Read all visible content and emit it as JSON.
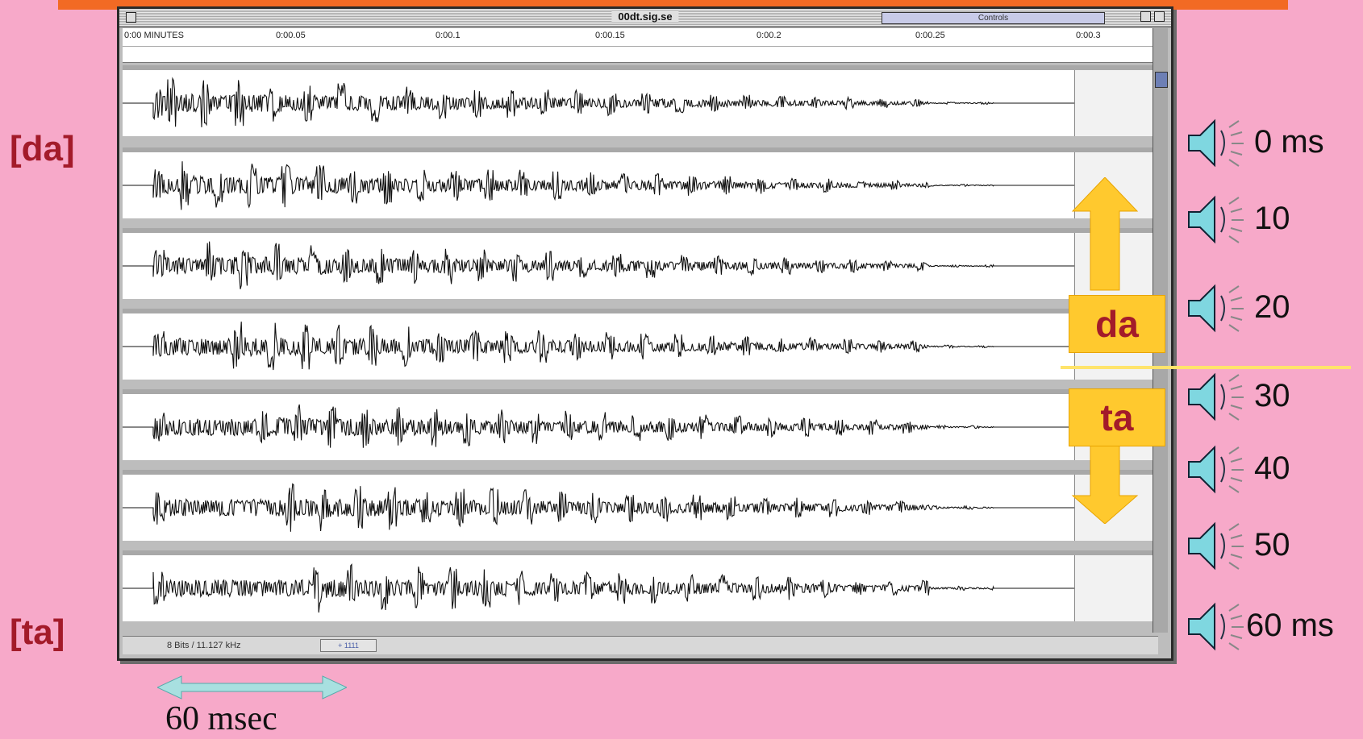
{
  "window": {
    "title": "00dt.sig.se",
    "controls_label": "Controls",
    "format_label": "8 Bits / 11.127 kHz",
    "mini_text": "+ 1111"
  },
  "ruler": {
    "ticks": [
      "0:00 MINUTES",
      "0:00.05",
      "0:00.1",
      "0:00.15",
      "0:00.2",
      "0:00.25",
      "0:00.3"
    ]
  },
  "tracks": [
    {
      "vot_ms": 0
    },
    {
      "vot_ms": 10
    },
    {
      "vot_ms": 20
    },
    {
      "vot_ms": 30
    },
    {
      "vot_ms": 40
    },
    {
      "vot_ms": 50
    },
    {
      "vot_ms": 60
    }
  ],
  "labels": {
    "da_top": "[da]",
    "ta_bottom": "[ta]",
    "box_da": "da",
    "box_ta": "ta",
    "scale_bar": "60 msec"
  },
  "speakers": [
    {
      "label": "0 ms"
    },
    {
      "label": "10"
    },
    {
      "label": "20"
    },
    {
      "label": "30"
    },
    {
      "label": "40"
    },
    {
      "label": "50"
    },
    {
      "label": "60 ms"
    }
  ],
  "colors": {
    "background": "#f7a9c9",
    "label_red": "#a31b2a",
    "arrow_yellow": "#ffc92e",
    "scale_arrow": "#a8e0e0"
  }
}
